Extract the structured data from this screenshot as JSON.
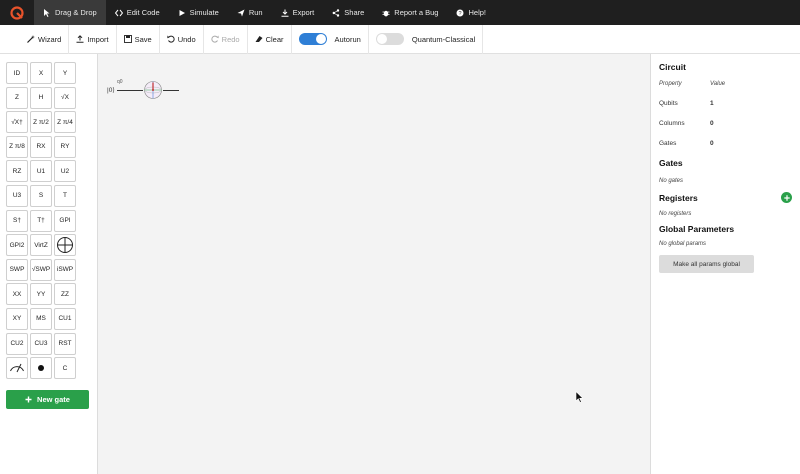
{
  "nav": {
    "logo_icon": "quirk-logo-icon",
    "items": [
      {
        "label": "Drag & Drop",
        "icon": "cursor-icon",
        "active": true
      },
      {
        "label": "Edit Code",
        "icon": "code-icon"
      },
      {
        "label": "Simulate",
        "icon": "play-icon"
      },
      {
        "label": "Run",
        "icon": "plane-icon"
      },
      {
        "label": "Export",
        "icon": "download-icon"
      },
      {
        "label": "Share",
        "icon": "share-icon"
      },
      {
        "label": "Report a Bug",
        "icon": "bug-icon"
      },
      {
        "label": "Help!",
        "icon": "help-icon"
      }
    ]
  },
  "toolbar": {
    "wizard": "Wizard",
    "import": "Import",
    "save": "Save",
    "undo": "Undo",
    "redo": "Redo",
    "clear": "Clear",
    "autorun": "Autorun",
    "autorun_on": true,
    "quantum_classical": "Quantum-Classical",
    "quantum_classical_on": false
  },
  "gates": [
    "ID",
    "X",
    "Y",
    "Z",
    "H",
    "√X",
    "√X†",
    "Z π/2",
    "Z π/4",
    "Z π/8",
    "RX",
    "RY",
    "RZ",
    "U1",
    "U2",
    "U3",
    "S",
    "T",
    "S†",
    "T†",
    "GPI",
    "GPI2",
    "VirtZ",
    "",
    "SWP",
    "√SWP",
    "iSWP",
    "XX",
    "YY",
    "ZZ",
    "XY",
    "MS",
    "CU1",
    "CU2",
    "CU3",
    "RST",
    "",
    "",
    "C"
  ],
  "new_gate": "New gate",
  "circuit_canvas": {
    "qubit_ket": "|0⟩",
    "qubit_label": "q0"
  },
  "panel": {
    "circuit_title": "Circuit",
    "prop_header": {
      "property": "Property",
      "value": "Value"
    },
    "props": [
      {
        "key": "Qubits",
        "value": "1"
      },
      {
        "key": "Columns",
        "value": "0"
      },
      {
        "key": "Gates",
        "value": "0"
      }
    ],
    "gates_title": "Gates",
    "no_gates": "No gates",
    "registers_title": "Registers",
    "no_registers": "No registers",
    "global_params_title": "Global Parameters",
    "no_global_params": "No global params",
    "make_global_btn": "Make all params global"
  },
  "colors": {
    "nav_bg": "#1f1f1f",
    "accent_blue": "#2f7fd6",
    "accent_green": "#2aa04a",
    "logo_orange": "#e8532b"
  }
}
